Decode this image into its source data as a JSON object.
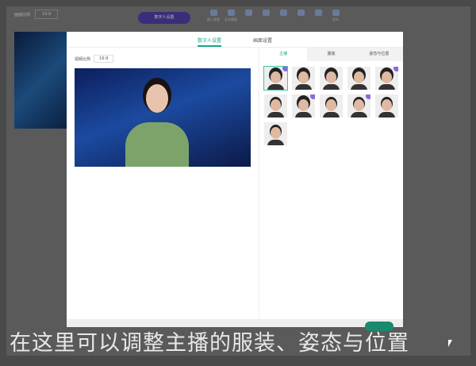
{
  "toolbar": {
    "ratio_label": "画面比例",
    "ratio_value": "16:9",
    "digital_human_button": "数字人设置",
    "tools": [
      "插入视频",
      "文本替换",
      "",
      "",
      "",
      "",
      "",
      "发布"
    ]
  },
  "modal": {
    "tabs": [
      {
        "label": "数字人设置",
        "active": true
      },
      {
        "label": "画面设置",
        "active": false
      }
    ],
    "video_ratio_label": "视频比例",
    "video_ratio_value": "16:9",
    "right_tabs": [
      {
        "label": "主播",
        "active": true
      },
      {
        "label": "服装",
        "active": false
      },
      {
        "label": "姿态与位置",
        "active": false
      }
    ],
    "avatars": [
      {
        "gender": "female",
        "selected": true,
        "badge": true
      },
      {
        "gender": "female",
        "badge": false
      },
      {
        "gender": "female",
        "badge": false
      },
      {
        "gender": "female",
        "badge": false
      },
      {
        "gender": "female",
        "badge": true
      },
      {
        "gender": "male",
        "badge": false
      },
      {
        "gender": "female",
        "badge": true
      },
      {
        "gender": "male",
        "badge": false
      },
      {
        "gender": "male",
        "badge": true
      },
      {
        "gender": "male",
        "badge": false
      },
      {
        "gender": "male",
        "badge": false
      }
    ]
  },
  "subtitle": "在这里可以调整主播的服装、姿态与位置",
  "colors": {
    "accent": "#1aa58a",
    "badge": "#8a6ad8",
    "button": "#3a2e7a"
  }
}
